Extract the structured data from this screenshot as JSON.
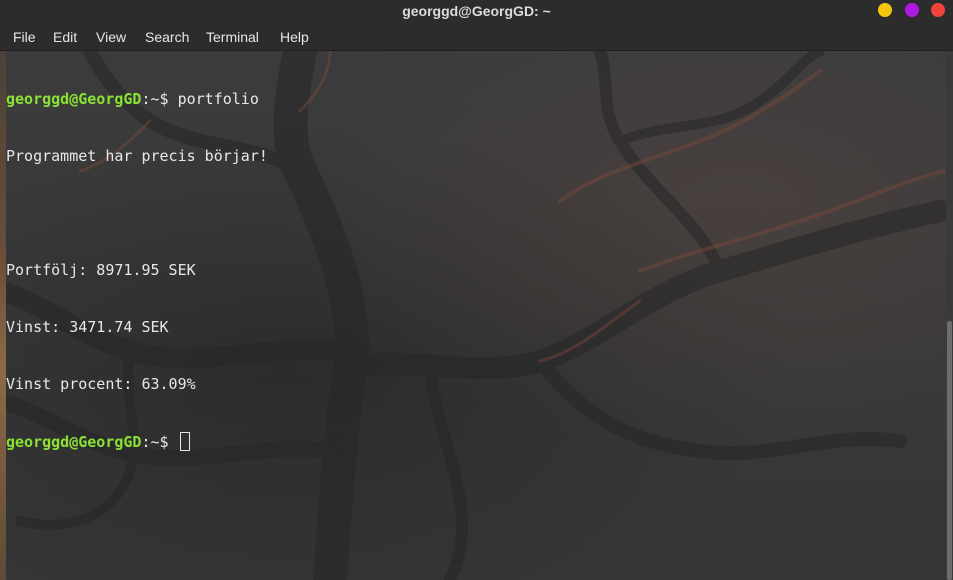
{
  "window": {
    "title": "georggd@GeorgGD: ~",
    "controls": [
      {
        "name": "minimize",
        "color": "#f6c60d"
      },
      {
        "name": "maximize",
        "color": "#b118e3"
      },
      {
        "name": "close",
        "color": "#f0443b"
      }
    ]
  },
  "menu": {
    "items": [
      "File",
      "Edit",
      "View",
      "Search",
      "Terminal",
      "Help"
    ]
  },
  "terminal": {
    "lines": [
      {
        "type": "prompt",
        "user": "georggd@GeorgGD",
        "path": ":~$ ",
        "command": "portfolio"
      },
      {
        "type": "text",
        "text": "Programmet har precis börjar!"
      },
      {
        "type": "text",
        "text": ""
      },
      {
        "type": "text",
        "text": "Portfölj: 8971.95 SEK"
      },
      {
        "type": "text",
        "text": "Vinst: 3471.74 SEK"
      },
      {
        "type": "text",
        "text": "Vinst procent: 63.09%"
      },
      {
        "type": "prompt",
        "user": "georggd@GeorgGD",
        "path": ":~$ ",
        "command": ""
      }
    ],
    "colors": {
      "prompt_user": "#8ae234",
      "text": "#e8e8e8"
    }
  }
}
